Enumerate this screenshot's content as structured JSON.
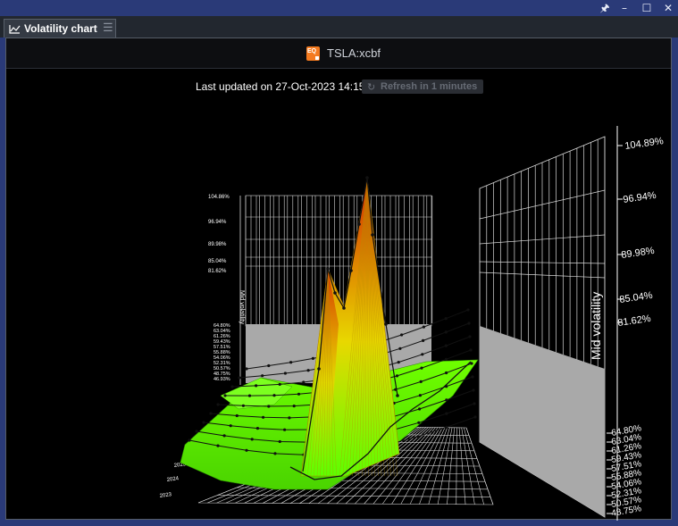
{
  "window": {
    "pin_icon": "pin-icon",
    "minimize_icon": "minimize-icon",
    "maximize_icon": "maximize-icon",
    "close_icon": "close-icon"
  },
  "tab": {
    "label": "Volatility chart",
    "icon": "line-chart-icon",
    "menu_icon": "hamburger-menu-icon"
  },
  "header": {
    "symbol": "TSLA:xcbf",
    "badge_text": "EQ",
    "badge_color": "#f47a1f"
  },
  "status": {
    "last_updated": "Last updated on 27-Oct-2023 14:15",
    "refresh_label": "Refresh in 1 minutes"
  },
  "chart_data": {
    "type": "surface",
    "z_axis_label": "Mid volatility",
    "z_ticks_main": [
      "104.89%",
      "96.94%",
      "89.98%",
      "85.04%",
      "81.62%"
    ],
    "z_ticks_lower": [
      "64.80%",
      "63.04%",
      "61.26%",
      "59.43%",
      "57.51%",
      "55.88%",
      "54.06%",
      "52.31%",
      "50.57%",
      "48.75%"
    ],
    "z_ticks_back_main": [
      "104.86%",
      "96.94%",
      "89.98%",
      "85.04%",
      "81.62%"
    ],
    "z_ticks_back_lower": [
      "64.80%",
      "63.04%",
      "61.26%",
      "59.43%",
      "57.51%",
      "55.88%",
      "54.06%",
      "52.31%",
      "50.57%",
      "48.75%",
      "46.93%"
    ],
    "colors": {
      "high": "#d42a00",
      "mid": "#e8d800",
      "low": "#5cff00",
      "wall": "#a9a9a9",
      "grid": "#d8d8d8"
    }
  }
}
